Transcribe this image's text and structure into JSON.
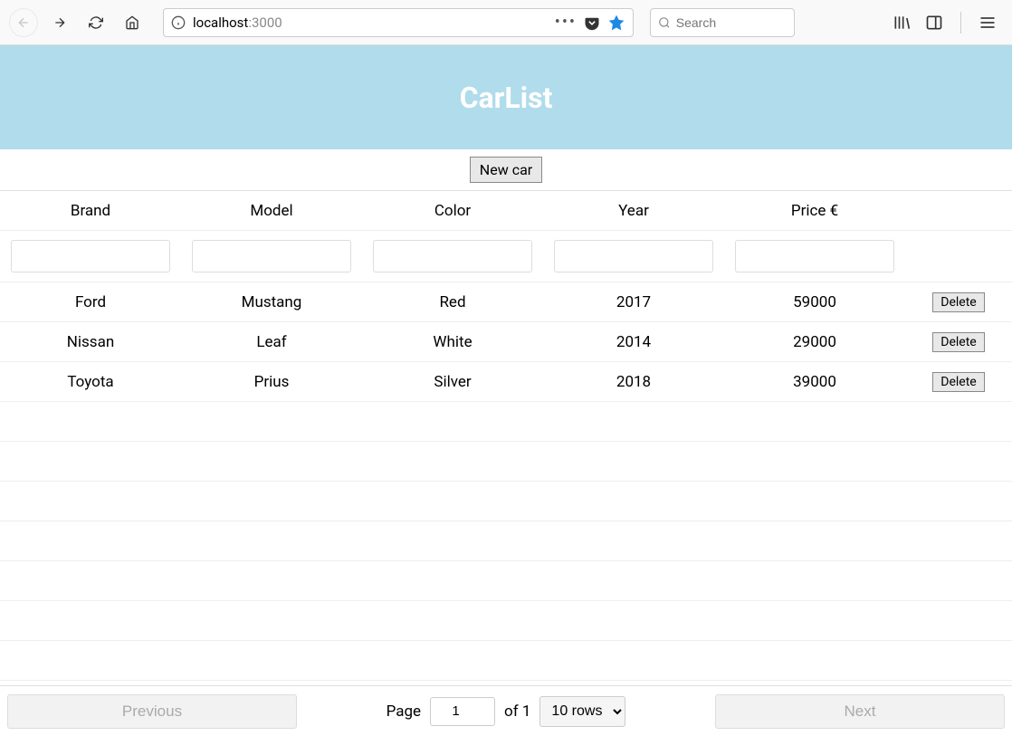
{
  "browser": {
    "url_host": "localhost",
    "url_port": ":3000",
    "search_placeholder": "Search"
  },
  "banner": {
    "title": "CarList"
  },
  "toolbar": {
    "new_car_label": "New car"
  },
  "table": {
    "headers": {
      "brand": "Brand",
      "model": "Model",
      "color": "Color",
      "year": "Year",
      "price": "Price €"
    },
    "delete_label": "Delete",
    "rows": [
      {
        "brand": "Ford",
        "model": "Mustang",
        "color": "Red",
        "year": "2017",
        "price": "59000"
      },
      {
        "brand": "Nissan",
        "model": "Leaf",
        "color": "White",
        "year": "2014",
        "price": "29000"
      },
      {
        "brand": "Toyota",
        "model": "Prius",
        "color": "Silver",
        "year": "2018",
        "price": "39000"
      }
    ]
  },
  "pagination": {
    "previous_label": "Previous",
    "next_label": "Next",
    "page_label": "Page",
    "of_label": "of 1",
    "page_value": "1",
    "rows_label": "10 rows"
  }
}
